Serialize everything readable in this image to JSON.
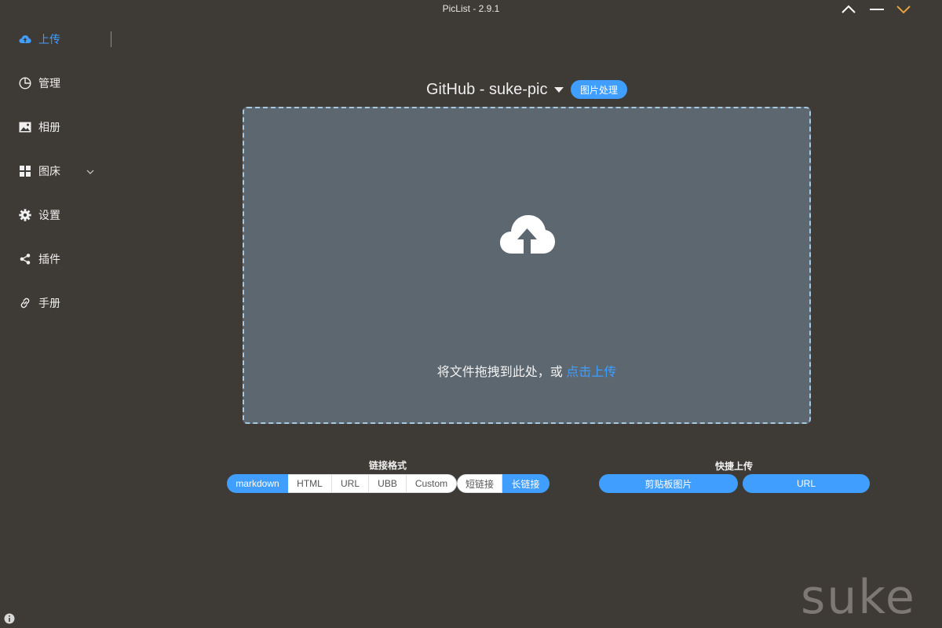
{
  "window": {
    "title": "PicList - 2.9.1",
    "controls": [
      "chevron-up-icon",
      "minimize-icon",
      "chevron-down-icon"
    ]
  },
  "sidebar": {
    "items": [
      {
        "label": "上传",
        "icon": "upload-cloud-icon",
        "active": true
      },
      {
        "label": "管理",
        "icon": "pie-chart-icon"
      },
      {
        "label": "相册",
        "icon": "image-icon"
      },
      {
        "label": "图床",
        "icon": "grid-icon",
        "expandable": true
      },
      {
        "label": "设置",
        "icon": "gear-icon"
      },
      {
        "label": "插件",
        "icon": "share-icon"
      },
      {
        "label": "手册",
        "icon": "link-icon"
      }
    ]
  },
  "upload": {
    "picbed": "GitHub - suke-pic",
    "image_process_label": "图片处理",
    "drop_text": "将文件拖拽到此处，或 ",
    "drop_link": "点击上传"
  },
  "link_format": {
    "label": "链接格式",
    "options": [
      "markdown",
      "HTML",
      "URL",
      "UBB",
      "Custom"
    ],
    "selected": "markdown",
    "link_types": [
      "短链接",
      "长链接"
    ],
    "selected_link_type": "长链接"
  },
  "quick_upload": {
    "label": "快捷上传",
    "buttons": [
      "剪贴板图片",
      "URL"
    ]
  },
  "watermark": "suke",
  "colors": {
    "background": "#3e3a35",
    "accent": "#409eff",
    "dropzone": "#5c6770",
    "window_accent": "#e6a23c"
  }
}
